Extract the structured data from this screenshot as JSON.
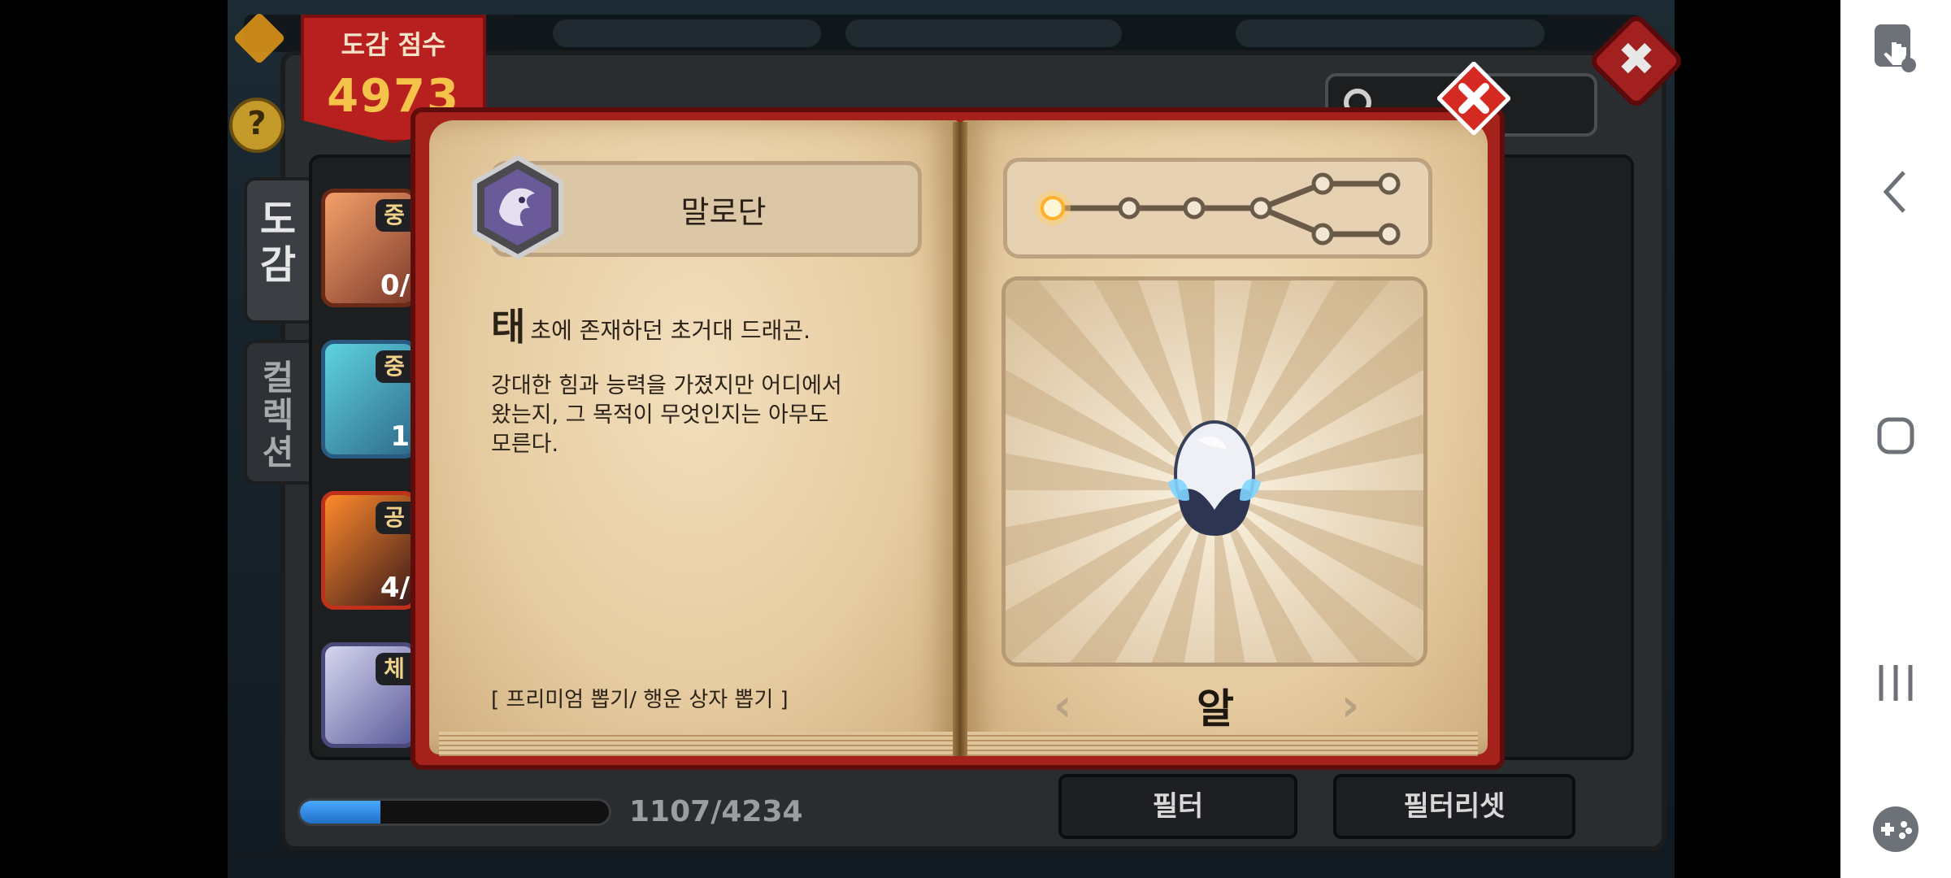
{
  "hud": {
    "score_label": "도감 점수",
    "score_value": "4973",
    "help_symbol": "?"
  },
  "tabs": {
    "dogam_label": "도감",
    "collection_label": "컬렉션"
  },
  "list": {
    "cards": [
      {
        "tag": "중",
        "count": "0/"
      },
      {
        "tag": "중",
        "count": "1"
      },
      {
        "tag": "공",
        "count": "4/"
      },
      {
        "tag": "체",
        "count": ""
      }
    ]
  },
  "progress": {
    "current": 1107,
    "total": 4234,
    "text": "1107/4234",
    "fraction": 0.2615
  },
  "buttons": {
    "filter": "필터",
    "filter_reset": "필터리셋"
  },
  "book": {
    "name": "말로단",
    "desc_dropcap": "태",
    "desc_first_rest": "초에 존재하던 초거대 드래곤.",
    "desc_body_lines": [
      "강대한 힘과 능력을 가졌지만 어디에서",
      "왔는지, 그 목적이 무엇인지는 아무도",
      "모른다."
    ],
    "acquire": "[ 프리미엄 뽑기/ 행운 상자 뽑기 ]",
    "stage_name": "알",
    "evolution_current_index": 0,
    "close_symbol": "✖"
  },
  "colors": {
    "book_cover": "#a5211b",
    "page": "#e6cba0",
    "score_badge": "#b82020",
    "score_value": "#f6c34a",
    "progress_fill": "#1f6fc7",
    "active_node": "#ffb02a"
  },
  "icons": {
    "close": "close-x-icon",
    "search": "search-icon",
    "help": "help-icon",
    "dragon_emblem": "dragon-emblem-icon",
    "egg": "egg-icon",
    "nav_back": "back-chevron-icon",
    "nav_home": "home-icon",
    "nav_recents": "recents-icon",
    "nav_gamepad": "game-tools-icon",
    "nav_touch": "touch-lock-icon"
  }
}
